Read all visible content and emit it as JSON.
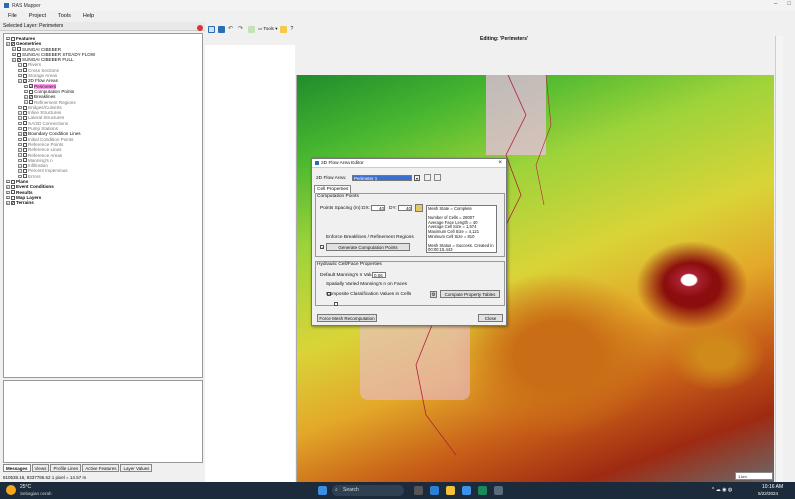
{
  "app": {
    "title": "RAS Mapper",
    "editing_label": "Editing: 'Perimeters'"
  },
  "menu": [
    "File",
    "Project",
    "Tools",
    "Help"
  ],
  "layer_panel_label": "Selected Layer: Perimeters",
  "tree": [
    {
      "label": "Features",
      "indent": 0,
      "checked": false,
      "bold": true
    },
    {
      "label": "Geometries",
      "indent": 0,
      "checked": true,
      "bold": true
    },
    {
      "label": "SUNGAI CIBEBER",
      "indent": 1,
      "checked": false
    },
    {
      "label": "SUNGAI CIBEBER STEADY FLOW",
      "indent": 1,
      "checked": false
    },
    {
      "label": "SUNGAI CIBEBER FULL",
      "indent": 1,
      "checked": true
    },
    {
      "label": "Rivers",
      "indent": 2,
      "checked": false,
      "gray": true
    },
    {
      "label": "Cross Sections",
      "indent": 2,
      "checked": false,
      "gray": true
    },
    {
      "label": "Storage Areas",
      "indent": 2,
      "checked": false,
      "gray": true
    },
    {
      "label": "2D Flow Areas",
      "indent": 2,
      "checked": true
    },
    {
      "label": "Perimeters",
      "indent": 3,
      "checked": true,
      "highlight": true
    },
    {
      "label": "Computation Points",
      "indent": 3,
      "checked": false
    },
    {
      "label": "Breaklines",
      "indent": 3,
      "checked": true
    },
    {
      "label": "Refinement Regions",
      "indent": 3,
      "checked": false,
      "gray": true
    },
    {
      "label": "Bridges/Culverts",
      "indent": 2,
      "checked": false,
      "gray": true
    },
    {
      "label": "Inline Structures",
      "indent": 2,
      "checked": false,
      "gray": true
    },
    {
      "label": "Lateral Structures",
      "indent": 2,
      "checked": false,
      "gray": true
    },
    {
      "label": "SA/2D Connections",
      "indent": 2,
      "checked": false,
      "gray": true
    },
    {
      "label": "Pump Stations",
      "indent": 2,
      "checked": false,
      "gray": true
    },
    {
      "label": "Boundary Condition Lines",
      "indent": 2,
      "checked": true
    },
    {
      "label": "Initial Condition Points",
      "indent": 2,
      "checked": false,
      "gray": true
    },
    {
      "label": "Reference Points",
      "indent": 2,
      "checked": false,
      "gray": true
    },
    {
      "label": "Reference Lines",
      "indent": 2,
      "checked": false,
      "gray": true
    },
    {
      "label": "Reference Areas",
      "indent": 2,
      "checked": false,
      "gray": true
    },
    {
      "label": "Manning's n",
      "indent": 2,
      "checked": false,
      "gray": true
    },
    {
      "label": "Infiltration",
      "indent": 2,
      "checked": false,
      "gray": true
    },
    {
      "label": "Percent Impervious",
      "indent": 2,
      "checked": false,
      "gray": true
    },
    {
      "label": "Errors",
      "indent": 2,
      "checked": false,
      "gray": true
    },
    {
      "label": "Plans",
      "indent": 0,
      "checked": false,
      "bold": true
    },
    {
      "label": "Event Conditions",
      "indent": 0,
      "checked": false,
      "bold": true
    },
    {
      "label": "Results",
      "indent": 0,
      "checked": false,
      "bold": true
    },
    {
      "label": "Map Layers",
      "indent": 0,
      "checked": false,
      "bold": true
    },
    {
      "label": "Terrains",
      "indent": 0,
      "checked": true,
      "bold": true
    }
  ],
  "bottom_tabs": [
    "Messages",
    "Views",
    "Profile Lines",
    "Active Features",
    "Layer Values"
  ],
  "status_text": "810538.16, 9337786.52  1 pixel = 14.57 m",
  "toolbar": {
    "tools_label": "Tools",
    "help_label": "?"
  },
  "dialog": {
    "title": "2D Flow Area Editor",
    "flow_area_label": "2D Flow Area:",
    "flow_area_value": "Perimeter 1",
    "tab": "Cell Properties",
    "comp_points_title": "Computation Points",
    "spacing_label": "Points Spacing (m):",
    "dx_label": "DX:",
    "dx_value": "40",
    "dy_label": "DY:",
    "dy_value": "40",
    "enforce_label": "Enforce Breaklines / Refinement Regions",
    "generate_label": "Generate Computation Points",
    "mesh_lines": [
      "Mesh State = Complete",
      "",
      "Number of Cells = 28007",
      "Average Face Length = 40",
      "Average Cell Size = 1,574",
      "Maximum Cell Size = 4,121",
      "Minimum Cell Size = 810",
      "",
      "Mesh Status = Success. Created in",
      "00:00:15.443"
    ],
    "hydraulic_title": "Hydraulic Cell/Face Properties",
    "manning_label": "Default Manning's n Value:",
    "manning_value": "0.06",
    "spatial_label": "Spatially Varied Manning's n on Faces",
    "composite_label": "Composite Classification Values in Cells",
    "compute_label": "Compute Property Tables",
    "force_label": "Force Mesh Recomputation",
    "close_label": "Close"
  },
  "taskbar": {
    "weather_temp": "25°C",
    "weather_desc": "Sebagian cerah",
    "search": "Search",
    "time": "10:16 AM",
    "date": "5/22/2024"
  },
  "scale_label": "1 km"
}
